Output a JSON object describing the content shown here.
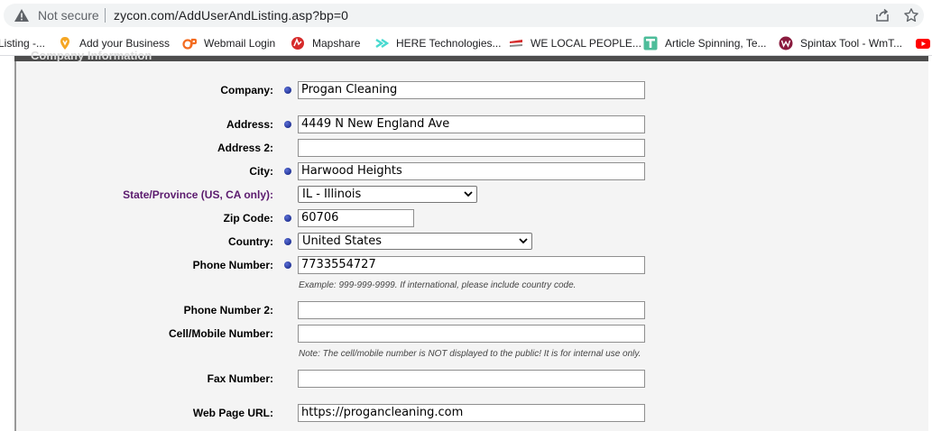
{
  "browser": {
    "security_label": "Not secure",
    "url": "zycon.com/AddUserAndListing.asp?bp=0"
  },
  "bookmarks": [
    {
      "label": "Listing -...",
      "icon": "page-icon"
    },
    {
      "label": "Add your Business",
      "icon": "location-pin-icon"
    },
    {
      "label": "Webmail Login",
      "icon": "cpanel-icon"
    },
    {
      "label": "Mapshare",
      "icon": "mapshare-icon"
    },
    {
      "label": "HERE Technologies...",
      "icon": "here-icon"
    },
    {
      "label": "WE LOCAL PEOPLE...",
      "icon": "welocal-icon"
    },
    {
      "label": "Article Spinning, Te...",
      "icon": "article-icon"
    },
    {
      "label": "Spintax Tool - WmT...",
      "icon": "spintax-icon"
    }
  ],
  "form": {
    "section_title": "Company Information",
    "company": {
      "label": "Company:",
      "value": "Progan Cleaning"
    },
    "address": {
      "label": "Address:",
      "value": "4449 N New England Ave"
    },
    "address2": {
      "label": "Address 2:",
      "value": ""
    },
    "city": {
      "label": "City:",
      "value": "Harwood Heights"
    },
    "state": {
      "label": "State/Province (US, CA only):",
      "value": "IL - Illinois"
    },
    "zip": {
      "label": "Zip Code:",
      "value": "60706"
    },
    "country": {
      "label": "Country:",
      "value": "United States"
    },
    "phone": {
      "label": "Phone Number:",
      "value": "7733554727",
      "note": "Example: 999-999-9999.  If international, please include country code."
    },
    "phone2": {
      "label": "Phone Number 2:",
      "value": ""
    },
    "cell": {
      "label": "Cell/Mobile Number:",
      "value": "",
      "note": "Note: The cell/mobile number is NOT displayed to the public! It is for internal use only."
    },
    "fax": {
      "label": "Fax Number:",
      "value": ""
    },
    "web": {
      "label": "Web Page URL:",
      "value": "https://progancleaning.com"
    }
  },
  "colors": {
    "required_dot": "#1a2a9e",
    "state_label": "#5b1a6e",
    "panel_bg": "#f4f4f4"
  }
}
